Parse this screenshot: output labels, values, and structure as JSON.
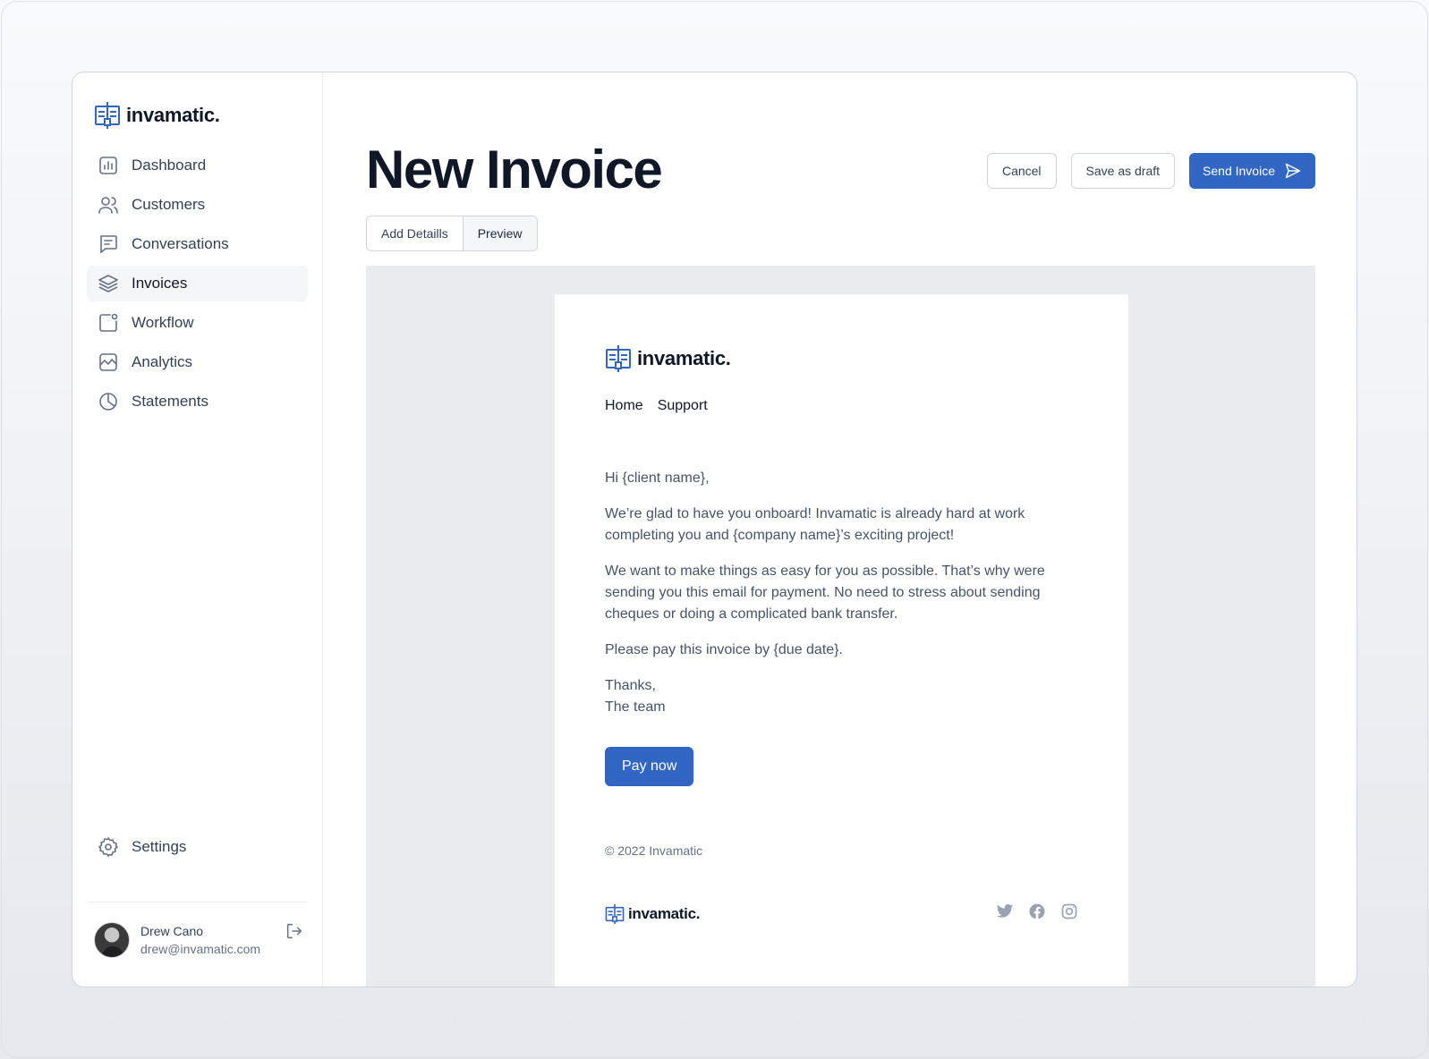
{
  "brand": {
    "name": "invamatic.",
    "accent": "#3266c3"
  },
  "sidebar": {
    "items": [
      {
        "label": "Dashboard",
        "icon": "bar-chart-icon"
      },
      {
        "label": "Customers",
        "icon": "users-icon"
      },
      {
        "label": "Conversations",
        "icon": "message-icon"
      },
      {
        "label": "Invoices",
        "icon": "layers-icon",
        "active": true
      },
      {
        "label": "Workflow",
        "icon": "workflow-icon"
      },
      {
        "label": "Analytics",
        "icon": "line-chart-icon"
      },
      {
        "label": "Statements",
        "icon": "pie-chart-icon"
      }
    ],
    "settings_label": "Settings",
    "user": {
      "name": "Drew Cano",
      "email": "drew@invamatic.com"
    }
  },
  "header": {
    "title": "New Invoice",
    "cancel_label": "Cancel",
    "draft_label": "Save as draft",
    "send_label": "Send Invoice"
  },
  "tabs": [
    {
      "label": "Add Detaills"
    },
    {
      "label": "Preview",
      "active": true
    }
  ],
  "email": {
    "brand": "invamatic.",
    "nav": [
      "Home",
      "Support"
    ],
    "greeting": "Hi {client name},",
    "paragraph1": "We’re glad to have you onboard! Invamatic is already hard at work completing you and {company name}’s exciting project!",
    "paragraph2": "We want to make things as easy for you as possible. That’s why were sending you this email for payment. No need  to stress about sending cheques or doing a complicated bank transfer.",
    "paragraph3": "Please pay this invoice by {due date}.",
    "signoff_line1": "Thanks,",
    "signoff_line2": "The team",
    "pay_label": "Pay now",
    "copyright": "© 2022 Invamatic",
    "footer_brand": "invamatic.",
    "socials": [
      "twitter-icon",
      "facebook-icon",
      "instagram-icon"
    ]
  }
}
